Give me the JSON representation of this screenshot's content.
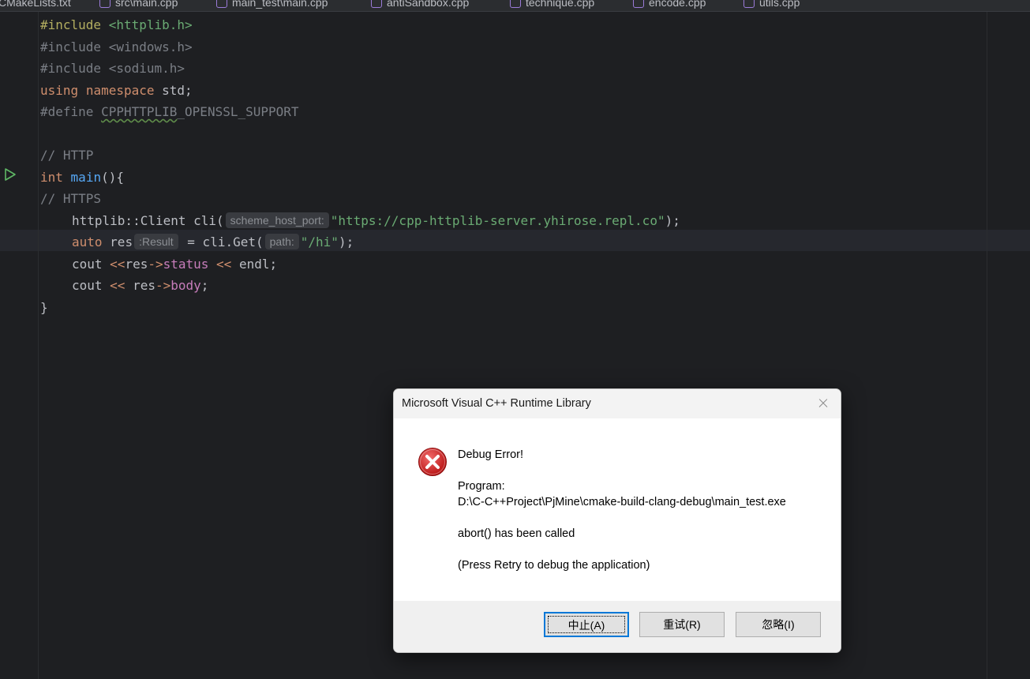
{
  "tabs": [
    {
      "label": "CMakeLists.txt",
      "active": false
    },
    {
      "label": "src\\main.cpp",
      "active": false
    },
    {
      "label": "main_test\\main.cpp",
      "active": true
    },
    {
      "label": "antiSandbox.cpp",
      "active": false
    },
    {
      "label": "technique.cpp",
      "active": false
    },
    {
      "label": "encode.cpp",
      "active": false
    },
    {
      "label": "utils.cpp",
      "active": false
    }
  ],
  "code": {
    "l1_kw": "#include",
    "l1_hdr": "<httplib.h>",
    "l2": "#include <windows.h>",
    "l3": "#include <sodium.h>",
    "l4_using": "using",
    "l4_ns": "namespace",
    "l4_rest": "std;",
    "l5_define": "#define",
    "l5_macro_a": "CPPHTTPLIB",
    "l5_macro_b": "_OPENSSL_SUPPORT",
    "l7": "// HTTP",
    "l8_type": "int",
    "l8_fn": "main",
    "l8_rest": "(){",
    "l9": "// HTTPS",
    "l10_a": "httplib::Client cli(",
    "l10_hint": "scheme_host_port:",
    "l10_str": "\"https://cpp-httplib-server.yhirose.repl.co\"",
    "l10_end": ");",
    "l11_kw": "auto",
    "l11_var": "res",
    "l11_hint": ":Result",
    "l11_mid": " = cli.Get(",
    "l11_hint2": "path:",
    "l11_str": "\"/hi\"",
    "l11_end": ");",
    "l12_a": "cout ",
    "l12_op1": "<<",
    "l12_b": "res",
    "l12_arrow": "->",
    "l12_mem": "status",
    "l12_op2": " << ",
    "l12_c": "endl;",
    "l13_a": "cout ",
    "l13_op": "<<",
    "l13_b": " res",
    "l13_arrow": "->",
    "l13_mem": "body",
    "l13_end": ";",
    "l14": "}"
  },
  "dialog": {
    "title": "Microsoft Visual C++ Runtime Library",
    "heading": "Debug Error!",
    "program_label": "Program:",
    "program_path": "D:\\C-C++Project\\PjMine\\cmake-build-clang-debug\\main_test.exe",
    "message": "abort() has been called",
    "hint": "(Press Retry to debug the application)",
    "buttons": {
      "abort": "中止(A)",
      "retry": "重试(R)",
      "ignore": "忽略(I)"
    }
  }
}
